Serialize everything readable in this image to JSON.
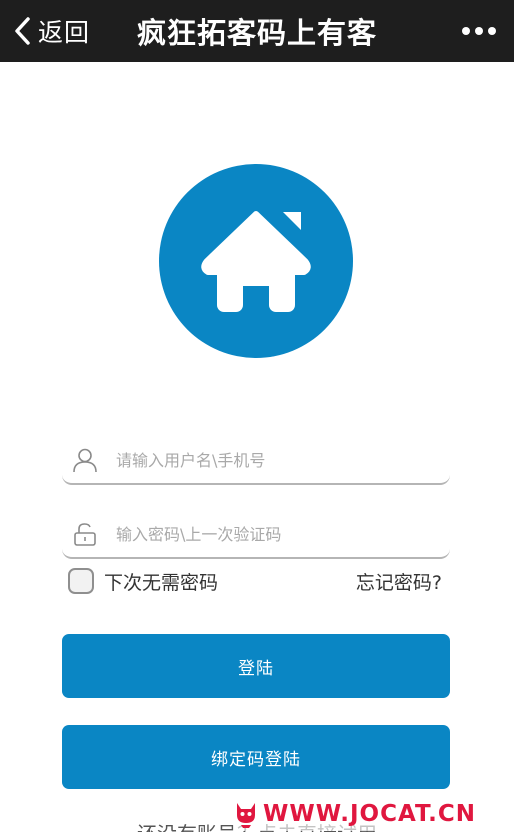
{
  "header": {
    "back_label": "返回",
    "title": "疯狂拓客码上有客"
  },
  "login": {
    "username_placeholder": "请输入用户名\\手机号",
    "password_placeholder": "输入密码\\上一次验证码",
    "remember_label": "下次无需密码",
    "forgot_label": "忘记密码?",
    "login_button": "登陆",
    "bind_button": "绑定码登陆",
    "register_text": "还没有账号？点击直接试用"
  },
  "watermark": {
    "text": "WWW.JOCAT.CN"
  },
  "colors": {
    "header_bg": "#1e1e1e",
    "accent": "#0a86c4",
    "watermark": "#e0173f"
  },
  "icons": {
    "back": "chevron-left-icon",
    "more": "more-dots-icon",
    "logo": "home-icon",
    "username": "user-icon",
    "password": "lock-icon"
  }
}
